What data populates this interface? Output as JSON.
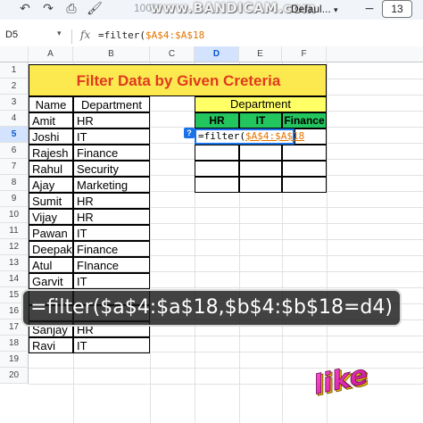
{
  "toolbar": {
    "undo_icon": "undo-icon",
    "redo_icon": "redo-icon",
    "print_icon": "print-icon",
    "paint_format_icon": "paint-format-icon",
    "zoom": "100%",
    "watermark": "www.BANDICAM.com",
    "font": "Defaul...",
    "font_size": "13"
  },
  "formula_bar": {
    "cell_ref": "D5",
    "fx": "fx",
    "formula_prefix": "=filter(",
    "formula_ref": "$A$4:$A$18"
  },
  "columns": [
    "A",
    "B",
    "C",
    "D",
    "E",
    "F"
  ],
  "rows": [
    "1",
    "2",
    "3",
    "4",
    "5",
    "6",
    "7",
    "8",
    "9",
    "10",
    "11",
    "12",
    "13",
    "14",
    "15",
    "16",
    "17",
    "18",
    "19",
    "20"
  ],
  "sheet": {
    "title": "Filter Data by Given Creteria",
    "name_header": "Name",
    "dept_header": "Department",
    "people": [
      {
        "name": "Amit",
        "dept": "HR"
      },
      {
        "name": "Joshi",
        "dept": "IT"
      },
      {
        "name": "Rajesh",
        "dept": "Finance"
      },
      {
        "name": "Rahul",
        "dept": "Security"
      },
      {
        "name": "Ajay",
        "dept": "Marketing"
      },
      {
        "name": "Sumit",
        "dept": "HR"
      },
      {
        "name": "Vijay",
        "dept": "HR"
      },
      {
        "name": "Pawan",
        "dept": "IT"
      },
      {
        "name": "Deepak",
        "dept": "Finance"
      },
      {
        "name": "Atul",
        "dept": "FInance"
      },
      {
        "name": "Garvit",
        "dept": "IT"
      },
      {
        "name": "",
        "dept": ""
      },
      {
        "name": "",
        "dept": ""
      },
      {
        "name": "Sanjay",
        "dept": "HR"
      },
      {
        "name": "Ravi",
        "dept": "IT"
      }
    ],
    "criteria_header": "Department",
    "criteria": [
      "HR",
      "IT",
      "Finance"
    ],
    "active_cell_prefix": "=filter(",
    "active_cell_ref": "$A$4:$A$18"
  },
  "caption": "=filter($a$4:$a$18,$b$4:$b$18=d4)",
  "sticker": "like",
  "colors": {
    "title_fill": "#fce94f",
    "title_text": "#e03a1e",
    "criteria_fill": "#ffff66",
    "criteria_header_fill": "#22c55e",
    "selection": "#1a73e8"
  }
}
